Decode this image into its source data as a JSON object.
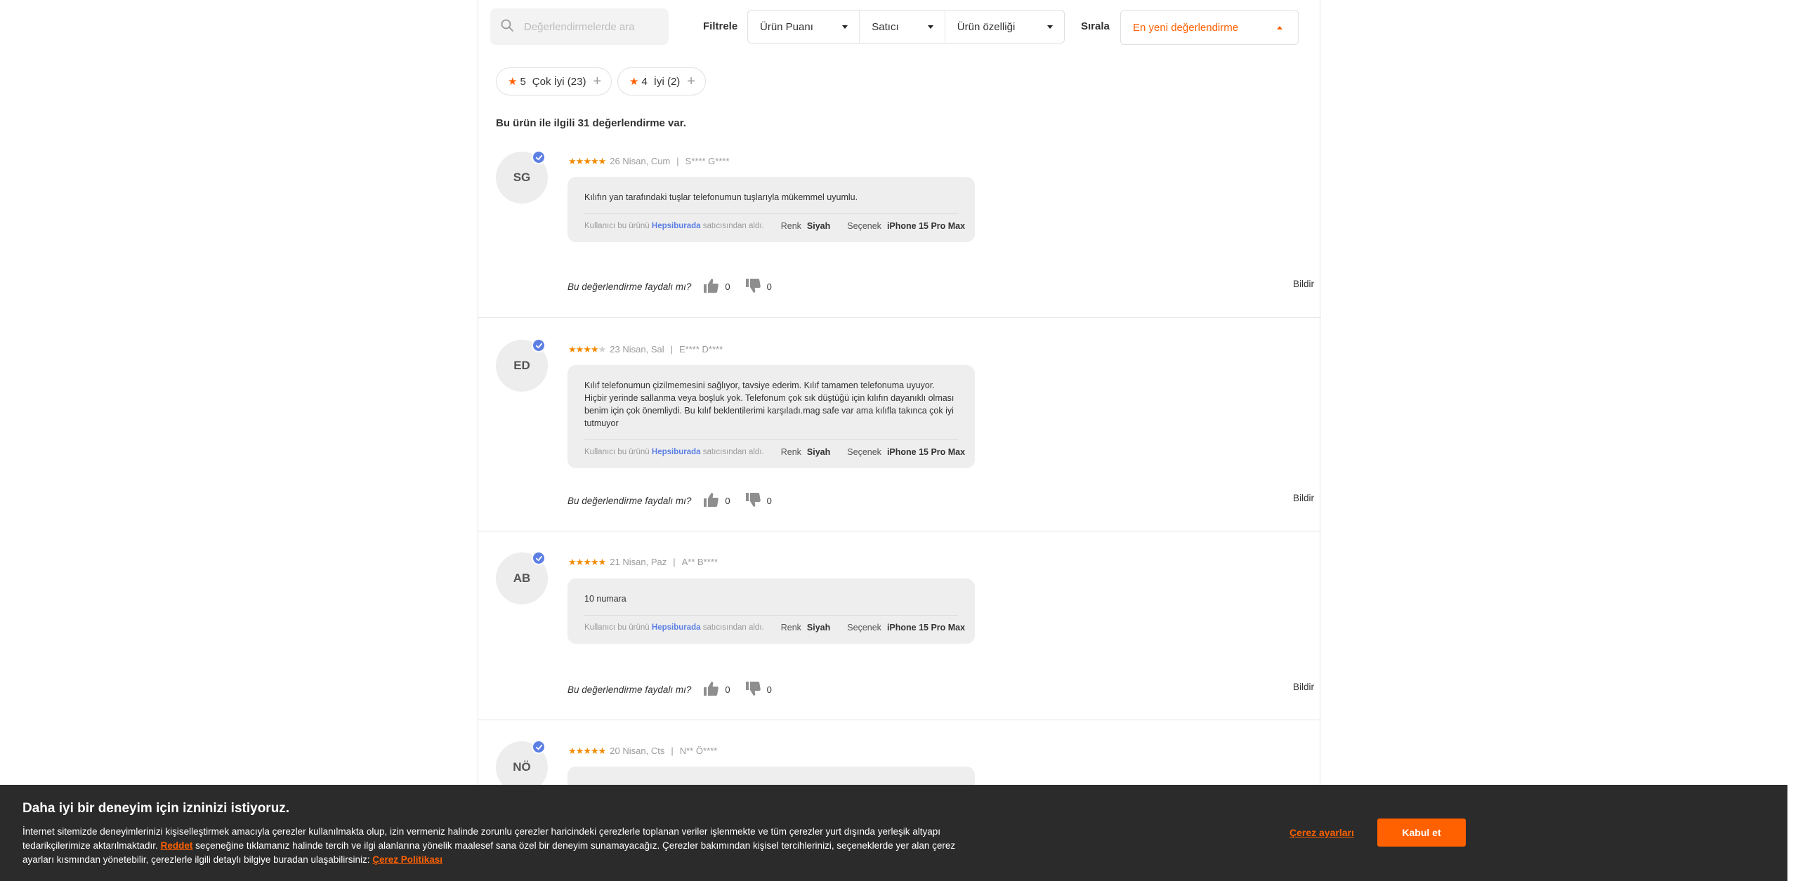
{
  "toolbar": {
    "search_placeholder": "Değerlendirmelerde ara",
    "filter_label": "Filtrele",
    "filters": [
      "Ürün Puanı",
      "Satıcı",
      "Ürün özelliği"
    ],
    "sort_label": "Sırala",
    "sort_value": "En yeni değerlendirme"
  },
  "chips": [
    {
      "stars": "5",
      "label": "Çok İyi (23)"
    },
    {
      "stars": "4",
      "label": "İyi (2)"
    }
  ],
  "summary": "Bu ürün ile ilgili 31 değerlendirme var.",
  "reviews": [
    {
      "initials": "SG",
      "rating": 5,
      "date": "26 Nisan, Cum",
      "user": "S**** G****",
      "text": "Kılıfın yan tarafındaki tuşlar telefonumun tuşlarıyla mükemmel uyumlu.",
      "buyer_prefix": "Kullanıcı bu ürünü",
      "seller": "Hepsiburada",
      "buyer_suffix": "satıcısından aldı.",
      "color_key": "Renk",
      "color_value": "Siyah",
      "option_key": "Seçenek",
      "option_value": "iPhone 15 Pro Max",
      "helpful_q": "Bu değerlendirme faydalı mı?",
      "likes": "0",
      "dislikes": "0",
      "report": "Bildir"
    },
    {
      "initials": "ED",
      "rating": 4,
      "date": "23 Nisan, Sal",
      "user": "E**** D****",
      "text": "Kılıf telefonumun çizilmemesini sağlıyor, tavsiye ederim. Kılıf tamamen telefonuma uyuyor. Hiçbir yerinde sallanma veya boşluk yok. Telefonum çok sık düştüğü için kılıfın dayanıklı olması benim için çok önemliydi. Bu kılıf beklentilerimi karşıladı.mag safe var ama kılıfla takınca çok iyi tutmuyor",
      "buyer_prefix": "Kullanıcı bu ürünü",
      "seller": "Hepsiburada",
      "buyer_suffix": "satıcısından aldı.",
      "color_key": "Renk",
      "color_value": "Siyah",
      "option_key": "Seçenek",
      "option_value": "iPhone 15 Pro Max",
      "helpful_q": "Bu değerlendirme faydalı mı?",
      "likes": "0",
      "dislikes": "0",
      "report": "Bildir"
    },
    {
      "initials": "AB",
      "rating": 5,
      "date": "21 Nisan, Paz",
      "user": "A** B****",
      "text": "10 numara",
      "buyer_prefix": "Kullanıcı bu ürünü",
      "seller": "Hepsiburada",
      "buyer_suffix": "satıcısından aldı.",
      "color_key": "Renk",
      "color_value": "Siyah",
      "option_key": "Seçenek",
      "option_value": "iPhone 15 Pro Max",
      "helpful_q": "Bu değerlendirme faydalı mı?",
      "likes": "0",
      "dislikes": "0",
      "report": "Bildir"
    },
    {
      "initials": "NÖ",
      "rating": 5,
      "date": "20 Nisan, Cts",
      "user": "N** Ö****"
    }
  ],
  "cookie": {
    "title": "Daha iyi bir deneyim için izninizi istiyoruz.",
    "body_1": "İnternet sitemizde deneyimlerinizi kişiselleştirmek amacıyla çerezler kullanılmakta olup, izin vermeniz halinde zorunlu çerezler haricindeki çerezlerle toplanan veriler işlenmekte ve tüm çerezler yurt dışında yerleşik altyapı tedarikçilerimize aktarılmaktadır.",
    "reject_link": "Reddet",
    "body_2": "seçeneğine tıklamanız halinde tercih ve ilgi alanlarına yönelik maalesef sana özel bir deneyim sunamayacağız. Çerezler bakımından kişisel tercihlerinizi, seçeneklerde yer alan çerez ayarları kısmından yönetebilir, çerezlerle ilgili detaylı bilgiye buradan ulaşabilirsiniz:",
    "policy_link": "Çerez Politikası",
    "settings": "Çerez ayarları",
    "accept": "Kabul et"
  },
  "colors": {
    "accent": "#ff6000",
    "star": "#f28b00",
    "verified": "#5c7fe4",
    "cookie_bg": "#2b2b2b"
  }
}
